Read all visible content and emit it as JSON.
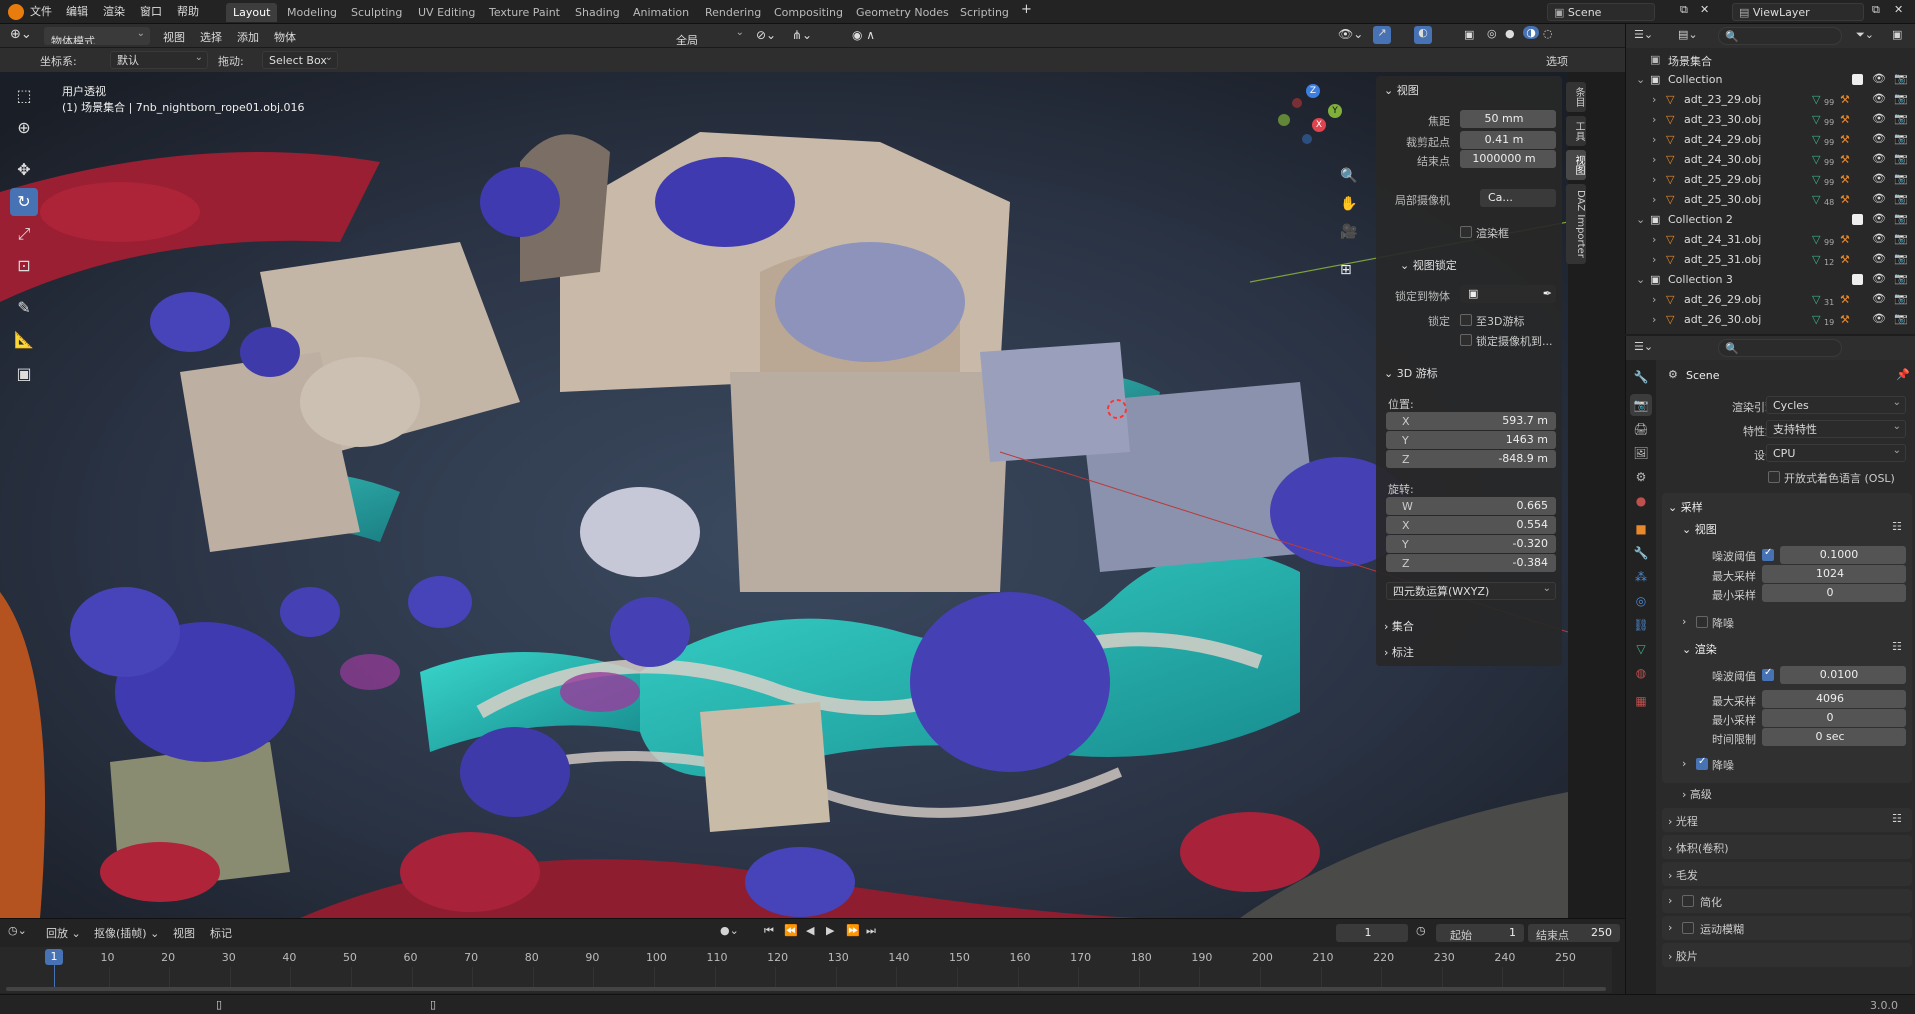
{
  "menus": [
    "文件",
    "编辑",
    "渲染",
    "窗口",
    "帮助"
  ],
  "workspaces": [
    "Layout",
    "Modeling",
    "Sculpting",
    "UV Editing",
    "Texture Paint",
    "Shading",
    "Animation",
    "Rendering",
    "Compositing",
    "Geometry Nodes",
    "Scripting"
  ],
  "active_workspace": "Layout",
  "scene_name": "Scene",
  "view_layer": "ViewLayer",
  "header": {
    "mode": "物体模式",
    "view": "视图",
    "select": "选择",
    "add": "添加",
    "object": "物体",
    "transform_orientation": "全局",
    "options": "选项"
  },
  "subheader": {
    "coord_label": "坐标系:",
    "coord_value": "默认",
    "drag_label": "拖动:",
    "drag_value": "Select Box"
  },
  "viewport": {
    "title_line1": "用户透视",
    "title_line2": "(1) 场景集合 | 7nb_nightborn_rope01.obj.016",
    "gizmo_x": "X",
    "gizmo_y": "Y",
    "gizmo_z": "Z"
  },
  "npanel": {
    "view_section": "视图",
    "focal_label": "焦距",
    "focal_value": "50 mm",
    "clip_start_label": "裁剪起点",
    "clip_start_value": "0.41 m",
    "clip_end_label": "结束点",
    "clip_end_value": "1000000 m",
    "local_camera_label": "局部摄像机",
    "local_camera_value": "Ca...",
    "render_region": "渲染框",
    "view_lock_section": "视图锁定",
    "lock_to_object_label": "锁定到物体",
    "lock_label": "锁定",
    "lock_to_cursor": "至3D游标",
    "lock_camera": "锁定摄像机到...",
    "cursor_section": "3D 游标",
    "location_label": "位置:",
    "loc_x_label": "X",
    "loc_x": "593.7 m",
    "loc_y_label": "Y",
    "loc_y": "1463 m",
    "loc_z_label": "Z",
    "loc_z": "-848.9 m",
    "rotation_label": "旋转:",
    "rot_w_label": "W",
    "rot_w": "0.665",
    "rot_x_label": "X",
    "rot_x": "0.554",
    "rot_y_label": "Y",
    "rot_y": "-0.320",
    "rot_z_label": "Z",
    "rot_z": "-0.384",
    "rotation_mode": "四元数运算(WXYZ)",
    "collection_section": "集合",
    "annotation_section": "标注"
  },
  "side_tabs": [
    "条目",
    "工具",
    "视图",
    "DAZ Importer"
  ],
  "outliner": {
    "root": "场景集合",
    "rows": [
      {
        "name": "Collection",
        "type": "collection",
        "indent": 1
      },
      {
        "name": "adt_23_29.obj",
        "type": "object",
        "indent": 2,
        "badge": "99"
      },
      {
        "name": "adt_23_30.obj",
        "type": "object",
        "indent": 2,
        "badge": "99"
      },
      {
        "name": "adt_24_29.obj",
        "type": "object",
        "indent": 2,
        "badge": "99"
      },
      {
        "name": "adt_24_30.obj",
        "type": "object",
        "indent": 2,
        "badge": "99"
      },
      {
        "name": "adt_25_29.obj",
        "type": "object",
        "indent": 2,
        "badge": "99"
      },
      {
        "name": "adt_25_30.obj",
        "type": "object",
        "indent": 2,
        "badge": "48"
      },
      {
        "name": "Collection 2",
        "type": "collection",
        "indent": 1
      },
      {
        "name": "adt_24_31.obj",
        "type": "object",
        "indent": 2,
        "badge": "99"
      },
      {
        "name": "adt_25_31.obj",
        "type": "object",
        "indent": 2,
        "badge": "12"
      },
      {
        "name": "Collection 3",
        "type": "collection",
        "indent": 1
      },
      {
        "name": "adt_26_29.obj",
        "type": "object",
        "indent": 2,
        "badge": "31"
      },
      {
        "name": "adt_26_30.obj",
        "type": "object",
        "indent": 2,
        "badge": "19"
      }
    ]
  },
  "properties": {
    "context": "Scene",
    "render_engine_label": "渲染引擎",
    "render_engine": "Cycles",
    "feature_set_label": "特性集",
    "feature_set": "支持特性",
    "device_label": "设备",
    "device": "CPU",
    "osl": "开放式着色语言 (OSL)",
    "sampling": "采样",
    "viewport": "视图",
    "noise_threshold_label": "噪波阈值",
    "vp_noise": "0.1000",
    "max_samples_label": "最大采样",
    "vp_max": "1024",
    "min_samples_label": "最小采样",
    "vp_min": "0",
    "denoise": "降噪",
    "render": "渲染",
    "r_noise": "0.0100",
    "r_max": "4096",
    "r_min": "0",
    "time_limit_label": "时间限制",
    "r_time": "0 sec",
    "advanced": "高级",
    "light_paths": "光程",
    "volumes": "体积(卷积)",
    "hair": "毛发",
    "simplify": "简化",
    "motion_blur": "运动模糊",
    "film": "胶片"
  },
  "timeline": {
    "playback": "回放",
    "keying": "抠像(插帧)",
    "view": "视图",
    "marker": "标记",
    "current_frame": "1",
    "start_label": "起始",
    "start": "1",
    "end_label": "结束点",
    "end": "250",
    "ticks": [
      "10",
      "20",
      "30",
      "40",
      "50",
      "60",
      "70",
      "80",
      "90",
      "100",
      "110",
      "120",
      "130",
      "140",
      "150",
      "160",
      "170",
      "180",
      "190",
      "200",
      "210",
      "220",
      "230",
      "240",
      "250"
    ],
    "playhead_label": "1"
  },
  "status": {
    "version": "3.0.0"
  },
  "colors": {
    "accent": "#4772b3",
    "teal_water": "#2fc4c0",
    "purple_trees": "#4a3fb0",
    "red_foliage": "#b0243a"
  }
}
